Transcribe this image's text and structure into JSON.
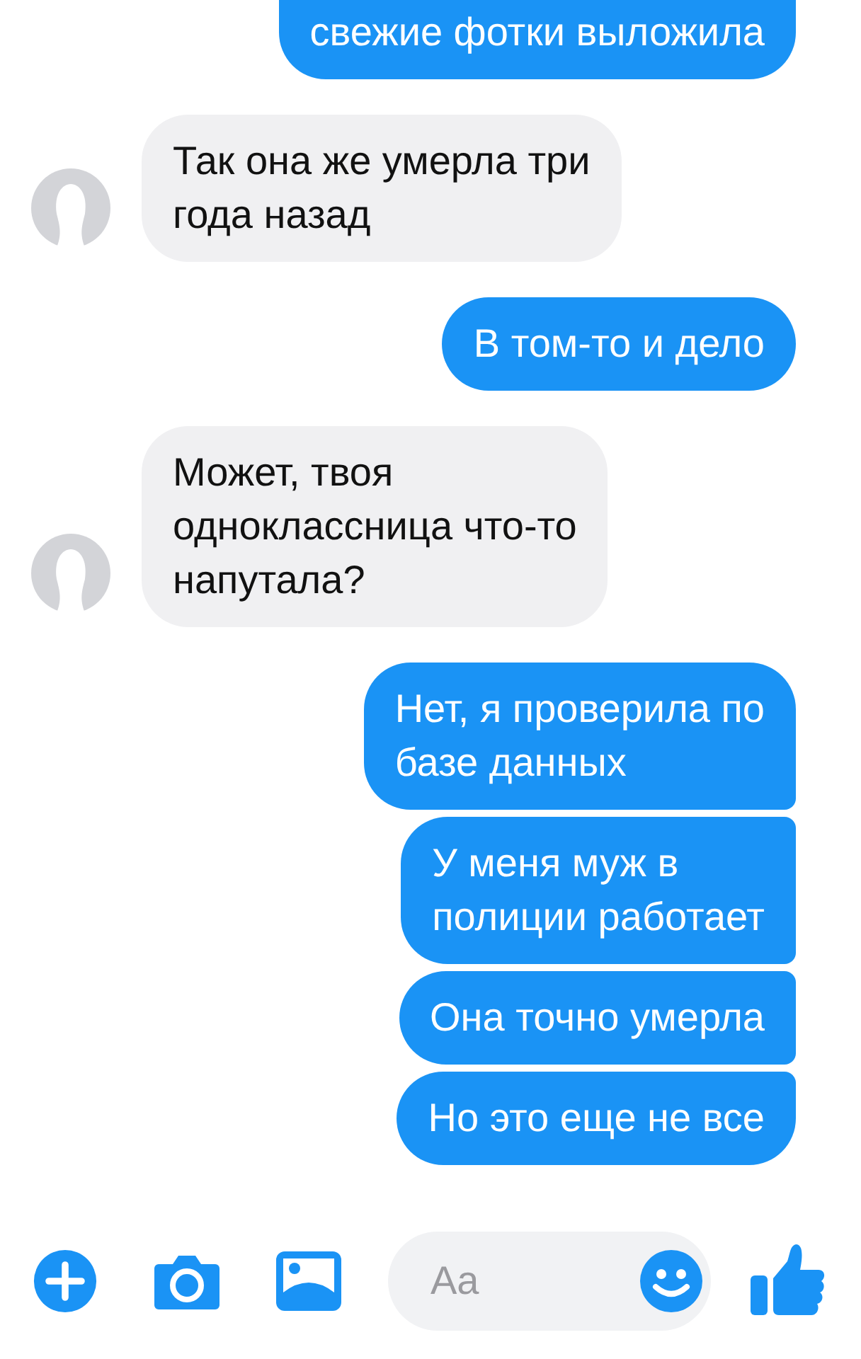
{
  "messages": [
    {
      "kind": "outgoing",
      "text": "свежие фотки выложила"
    },
    {
      "kind": "incoming",
      "text": "Так она же умерла три\nгода назад"
    },
    {
      "kind": "outgoing",
      "text": "В том-то и дело"
    },
    {
      "kind": "incoming",
      "text": "Может, твоя\nодноклассница что-то\nнапутала?"
    },
    {
      "kind": "outgoing",
      "text": "Нет, я проверила по\nбазе данных"
    },
    {
      "kind": "outgoing",
      "text": "У меня муж в\nполиции работает"
    },
    {
      "kind": "outgoing",
      "text": "Она точно умерла"
    },
    {
      "kind": "outgoing",
      "text": "Но это еще не все"
    }
  ],
  "composer": {
    "placeholder": "Aa"
  }
}
